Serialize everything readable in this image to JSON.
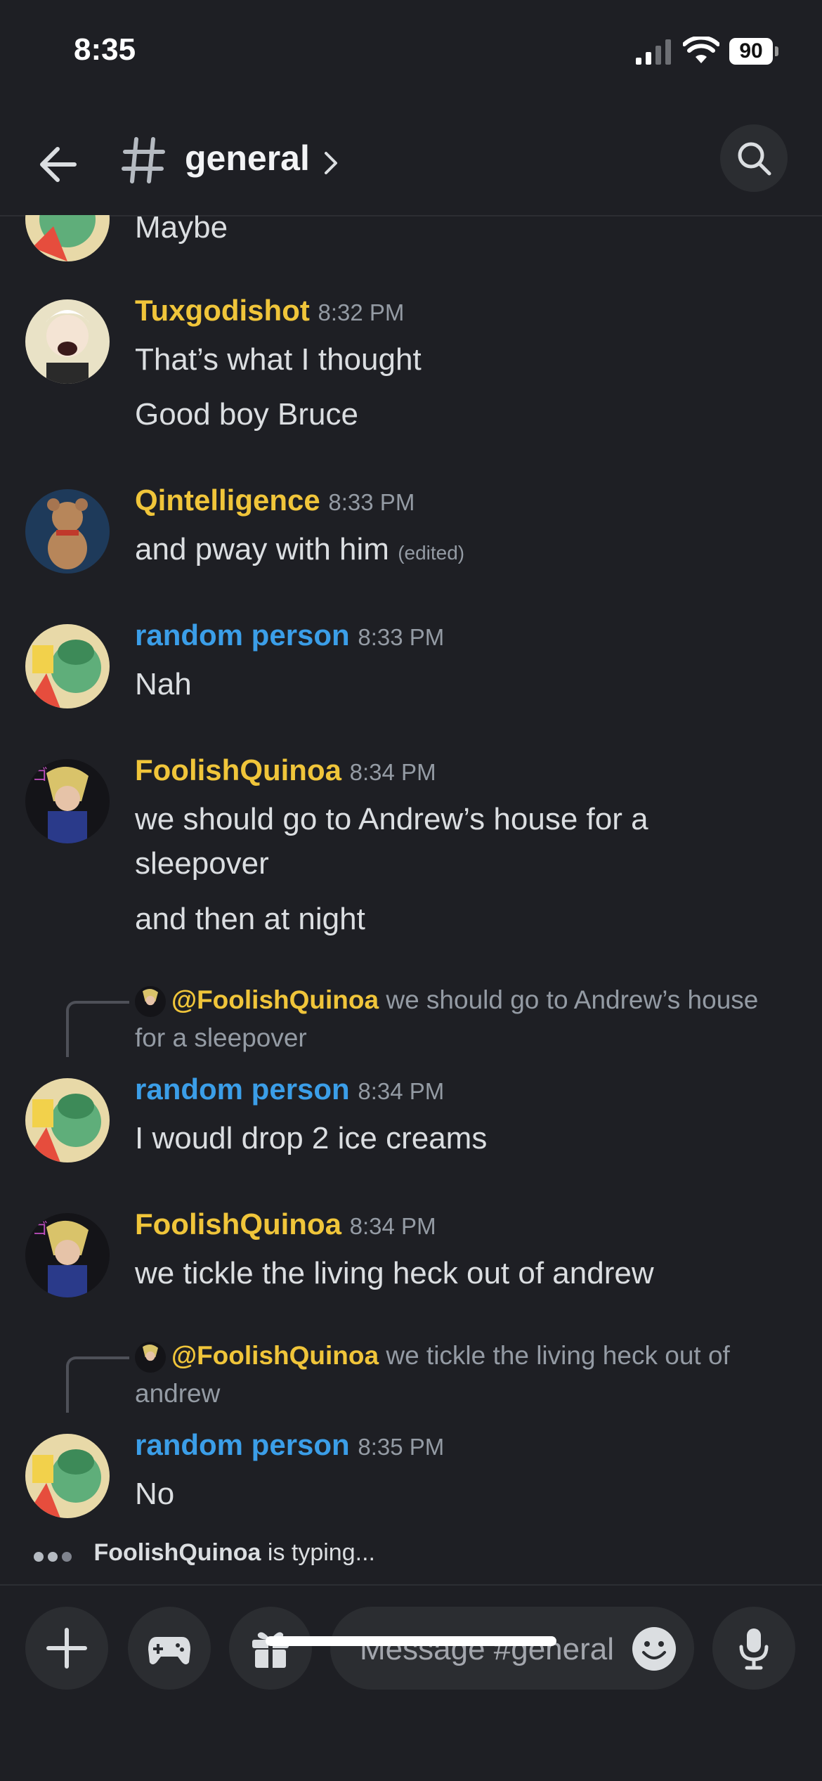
{
  "status_bar": {
    "time": "8:35",
    "battery": "90"
  },
  "header": {
    "channel_name": "general"
  },
  "partial_message": {
    "text": "Maybe"
  },
  "messages": [
    {
      "username": "Tuxgodishot",
      "time": "8:32 PM",
      "lines": [
        "That’s what I thought",
        "Good boy Bruce"
      ]
    },
    {
      "username": "Qintelligence",
      "time": "8:33 PM",
      "lines": [
        "and pway with him"
      ],
      "edited": "(edited)"
    },
    {
      "username": "random person",
      "time": "8:33 PM",
      "lines": [
        "Nah"
      ]
    },
    {
      "username": "FoolishQuinoa",
      "time": "8:34 PM",
      "lines": [
        "we should go to Andrew’s house for a sleepover",
        "and then at night"
      ]
    },
    {
      "reply": {
        "mention": "@FoolishQuinoa",
        "text": "we should go to Andrew’s house for a sleepover"
      },
      "username": "random person",
      "time": "8:34 PM",
      "lines": [
        "I woudl drop 2 ice creams"
      ]
    },
    {
      "username": "FoolishQuinoa",
      "time": "8:34 PM",
      "lines": [
        "we tickle the living heck out of andrew"
      ]
    },
    {
      "reply": {
        "mention": "@FoolishQuinoa",
        "text": "we tickle the living heck out of andrew"
      },
      "username": "random person",
      "time": "8:35 PM",
      "lines": [
        "No"
      ]
    }
  ],
  "typing": {
    "user": "FoolishQuinoa",
    "text": "is typing..."
  },
  "composer": {
    "placeholder": "Message #general"
  },
  "colors": {
    "background": "#1e1f24",
    "username_yellow": "#f0c53a",
    "username_blue": "#3b9ee8",
    "panel": "#2b2d31"
  },
  "icons": [
    "signal-icon",
    "wifi-icon",
    "battery-icon",
    "back-arrow-icon",
    "hash-icon",
    "chevron-right-icon",
    "search-icon",
    "plus-icon",
    "gamepad-icon",
    "gift-icon",
    "emoji-icon",
    "microphone-icon"
  ]
}
